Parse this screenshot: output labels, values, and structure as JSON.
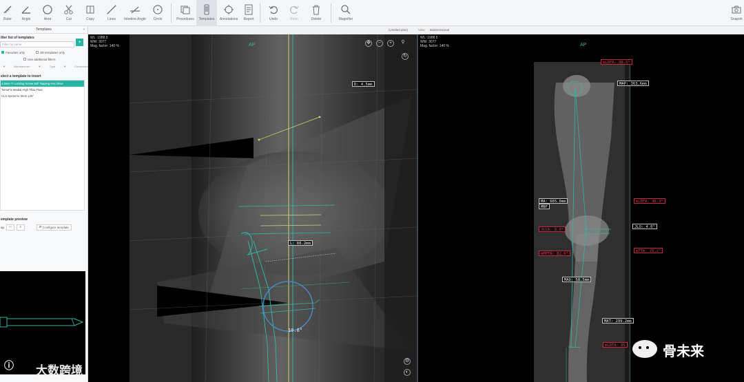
{
  "toolbar": {
    "tools": [
      {
        "name": "ruler",
        "label": "Ruler"
      },
      {
        "name": "angle",
        "label": "Angle"
      },
      {
        "name": "area",
        "label": "Area"
      },
      {
        "name": "cut",
        "label": "Cut"
      },
      {
        "name": "copy",
        "label": "Copy"
      },
      {
        "name": "lines",
        "label": "Lines"
      },
      {
        "name": "interline-angle",
        "label": "Interline Angle"
      },
      {
        "name": "circle",
        "label": "Circle"
      },
      {
        "name": "procedures",
        "label": "Procedures"
      },
      {
        "name": "templates",
        "label": "Templates"
      },
      {
        "name": "annotations",
        "label": "Annotations"
      },
      {
        "name": "report",
        "label": "Report"
      },
      {
        "name": "undo",
        "label": "Undo"
      },
      {
        "name": "redo",
        "label": "Redo"
      },
      {
        "name": "delete",
        "label": "Delete"
      },
      {
        "name": "magnifier",
        "label": "Magnifier"
      },
      {
        "name": "snapshot",
        "label": "Snapsh"
      }
    ]
  },
  "left_panel": {
    "title": "Templates",
    "filter_heading": "ilter list of templates",
    "filter_placeholder": "Filter by name",
    "favorites_label": "Favorites only",
    "modality_label": "3D templates only",
    "additional_filters_label": "Use additional filters",
    "filter_headers": [
      "Manufacturer",
      "Type",
      "Component"
    ],
    "select_heading": "elect a template to insert",
    "templates": [
      "4.0mm TI Locking Screw Self Tapping Hex Drive",
      "TomoFix Medial High Tibia Plate",
      "CLS Spotorno Stem 125°"
    ],
    "preview_heading": "emplate preview",
    "preview_zoom_label": "ap",
    "configure_label": "Configure template"
  },
  "viewport_bar": {
    "left_title": "(Untitled plan)",
    "view_label": "View",
    "view_mode": "Bidimensional"
  },
  "left_viewport": {
    "wl": "WL: 1988.5",
    "ww": "WW: 3077",
    "mag": "Mag. factor: 140 %",
    "projection": "AP",
    "measurements": [
      {
        "id": "d",
        "text": "D: 4.5mm"
      },
      {
        "id": "len",
        "text": "L: 66.2mm"
      },
      {
        "id": "angle",
        "text": "10.8°"
      }
    ]
  },
  "right_viewport": {
    "wl": "WL: 1988.5",
    "ww": "WW: 3077",
    "mag": "Mag. factor: 140 %",
    "projection": "AP",
    "measurements": [
      {
        "id": "mldfa-top",
        "text": "mLDFA: 88.0°",
        "tone": "r"
      },
      {
        "id": "map",
        "text": "MAP: 363.6mm",
        "tone": "w"
      },
      {
        "id": "ma",
        "text": "MA: 665.0mm",
        "tone": "w"
      },
      {
        "id": "mbf",
        "text": "MBF",
        "tone": "w"
      },
      {
        "id": "mldfa",
        "text": "mLDFA: 96.9°",
        "tone": "r"
      },
      {
        "id": "jlca",
        "text": "JLCA: 8.0°",
        "tone": "r"
      },
      {
        "id": "jlo",
        "text": "JLO: 4.0°",
        "tone": "w"
      },
      {
        "id": "mmpta",
        "text": "mMPTA: 82.6°",
        "tone": "r"
      },
      {
        "id": "mpta",
        "text": "mPTA: 29.2°",
        "tone": "r"
      },
      {
        "id": "mad",
        "text": "MAD: 58.5mm",
        "tone": "w"
      },
      {
        "id": "mat",
        "text": "MAT: 299.2mm",
        "tone": "w"
      },
      {
        "id": "mldta",
        "text": "mLDTA: 85",
        "tone": "r"
      }
    ]
  },
  "watermarks": {
    "left": "大数跨境",
    "right": "骨未来"
  }
}
